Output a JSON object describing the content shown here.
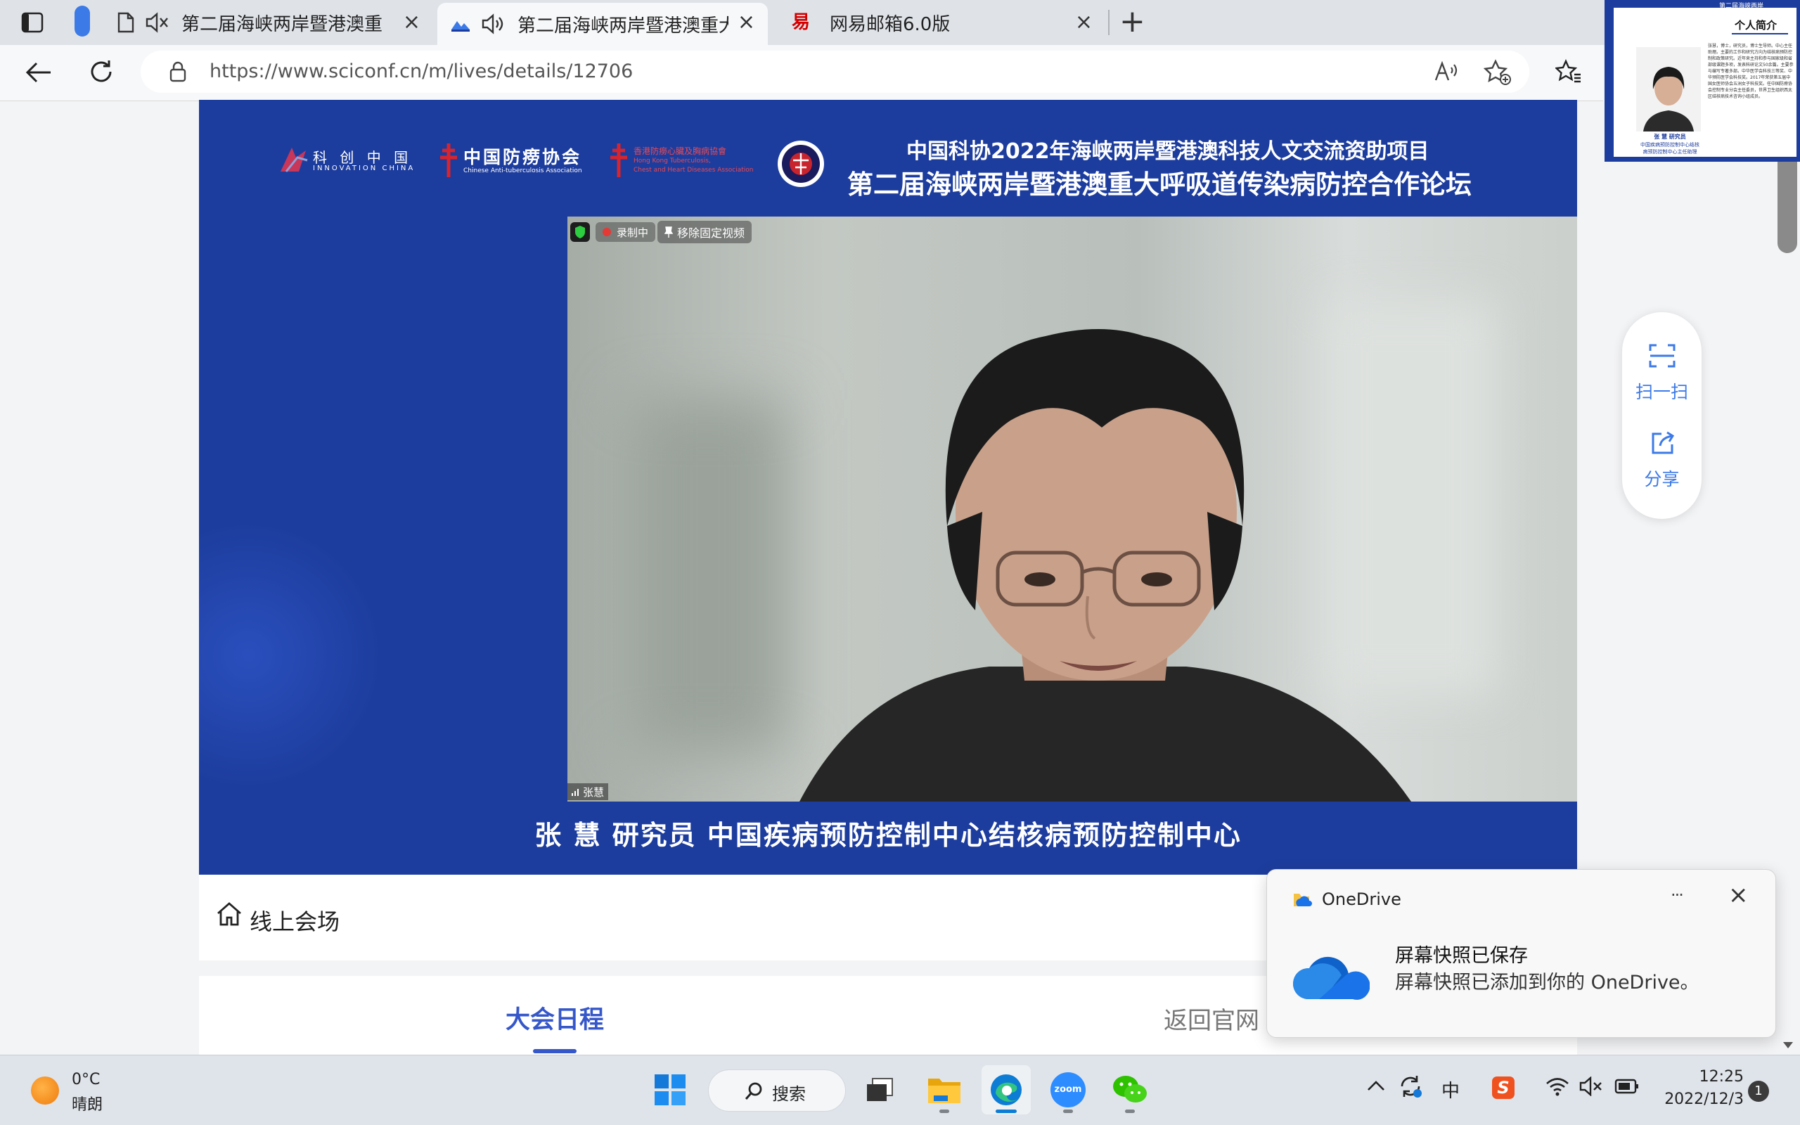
{
  "browser": {
    "tabs": [
      {
        "title": "第二届海峡两岸暨港澳重大呼吸道传染病防控合作论坛",
        "audio": "muted"
      },
      {
        "title": "第二届海峡两岸暨港澳重大呼吸道传染病防控合作论坛",
        "audio": "playing",
        "active": true
      },
      {
        "title": "网易邮箱6.0版"
      }
    ],
    "new_tab_label": "+",
    "url": "https://www.sciconf.cn/m/lives/details/12706",
    "close_glyph": "×"
  },
  "banner": {
    "logos": {
      "innovation_cn": "科 创 中 国",
      "innovation_en": "INNOVATION CHINA",
      "anti_tb_cn": "中国防痨协会",
      "anti_tb_en": "Chinese Anti-tuberculosis Association",
      "hk_cn": "香港防癆心臟及胸病協會",
      "hk_en_1": "Hong Kong Tuberculosis,",
      "hk_en_2": "Chest and Heart Diseases Association"
    },
    "title_line1": "中国科协2022年海峡两岸暨港澳科技人文交流资助项目",
    "title_line2": "第二届海峡两岸暨港澳重大呼吸道传染病防控合作论坛",
    "video": {
      "recording_label": "录制中",
      "unpin_label": "移除固定视频",
      "participant_name": "张慧"
    },
    "caption": "张 慧 研究员 中国疾病预防控制中心结核病预防控制中心"
  },
  "page": {
    "venue_label": "线上会场",
    "tabs": [
      "大会日程",
      "返回官网"
    ],
    "active_tab": 0
  },
  "side_panel": {
    "scan_label": "扫一扫",
    "share_label": "分享"
  },
  "pip": {
    "header": "第二届海峡两岸",
    "title": "个人简介",
    "bio": "张慧，博士，研究员，博士生导师。中心主任助理。主要的工作和研究方向为结核病预防控制和政策研究。近年来主持和参与国家级和省部级课题多项，发表科研论文50余篇。主要参与编写专著多部。中华医学会科技三等奖、中华预防医学会科技奖。2017年荣获第五届中国女医师协会五洲女子科技奖。任中国防痨协会控制专业分会主任委员，世界卫生组织西太区结核病技术咨询小组成员。",
    "name_title": "张 慧 研究员",
    "org_1": "中国疾病预防控制中心结核",
    "org_2": "病预防控制中心主任助理"
  },
  "onedrive": {
    "app_name": "OneDrive",
    "more_glyph": "···",
    "close_glyph": "×",
    "title": "屏幕快照已保存",
    "body": "屏幕快照已添加到你的 OneDrive。"
  },
  "taskbar": {
    "weather_temp": "0°C",
    "weather_desc": "晴朗",
    "search_label": "搜索",
    "zoom_label": "zoom",
    "ime": "中",
    "time": "12:25",
    "date": "2022/12/3",
    "notification_count": "1"
  },
  "colors": {
    "banner_blue": "#1d3d9e",
    "accent_blue": "#3c7ae8",
    "tab_active_text": "#3557c9"
  }
}
